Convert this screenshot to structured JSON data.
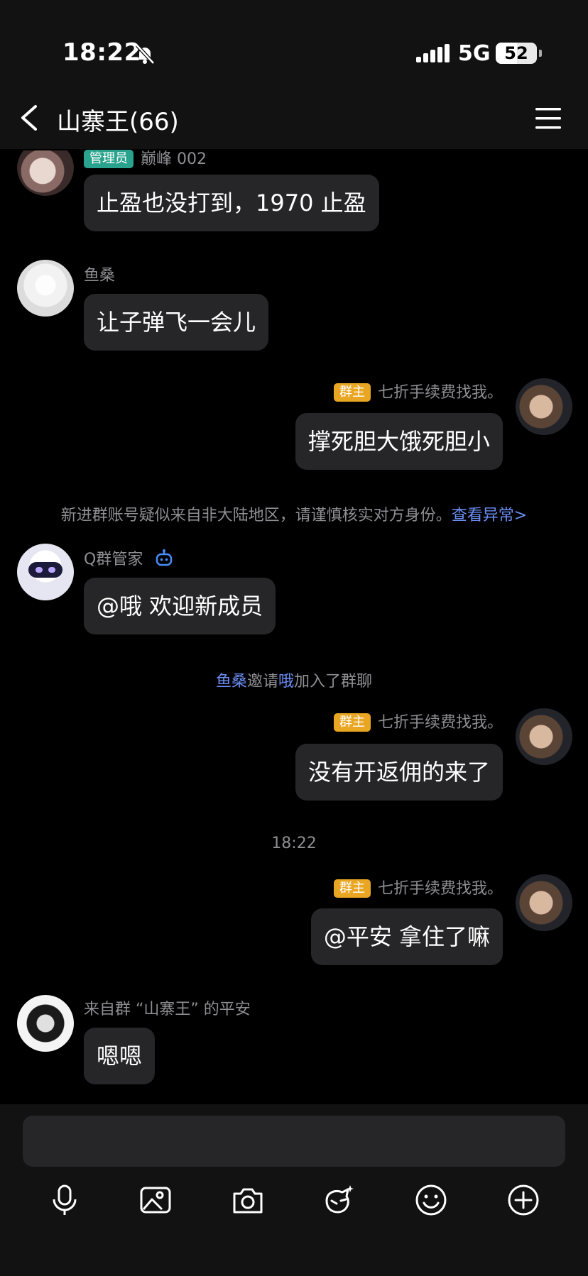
{
  "status_bar": {
    "time": "18:22",
    "network": "5G",
    "battery": "52"
  },
  "header": {
    "title": "山寨王(66)"
  },
  "messages": [
    {
      "name": "巅峰 002",
      "badge": "管理员",
      "text": "止盈也没打到，1970 止盈"
    },
    {
      "name": "鱼桑",
      "text": "让子弹飞一会儿"
    },
    {
      "name": "七折手续费找我。",
      "badge": "群主",
      "text": "撑死胆大饿死胆小"
    },
    {
      "name": "Q群管家",
      "text": "@哦 欢迎新成员"
    },
    {
      "name": "七折手续费找我。",
      "badge": "群主",
      "text": "没有开返佣的来了"
    },
    {
      "name": "七折手续费找我。",
      "badge": "群主",
      "text": "@平安 拿住了嘛"
    },
    {
      "name": "来自群 “山寨王” 的平安",
      "text": "嗯嗯"
    }
  ],
  "system": {
    "warning": "新进群账号疑似来自非大陆地区，请谨慎核实对方身份。",
    "warning_link": "查看异常>",
    "invite_a": "鱼桑",
    "invite_mid": "邀请",
    "invite_b": "哦",
    "invite_tail": "加入了群聊",
    "timestamp": "18:22"
  },
  "toolbar": {
    "icons": [
      "microphone-icon",
      "image-icon",
      "camera-icon",
      "sticker-icon",
      "emoji-icon",
      "plus-icon"
    ]
  },
  "colors": {
    "background": "#000000",
    "bubble": "#262628",
    "link": "#6c8ef5",
    "owner_badge": "#e9a623",
    "admin_badge": "#2aa38e"
  }
}
